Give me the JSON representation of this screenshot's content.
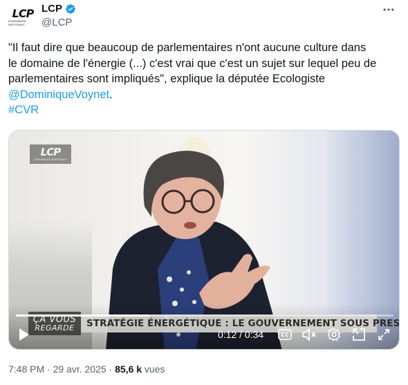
{
  "account": {
    "avatar_logo": "LCP",
    "avatar_logo_sub": "ASSEMBLÉE NATIONALE",
    "display_name": "LCP",
    "handle": "@LCP",
    "verified": true
  },
  "tweet": {
    "text_lines": [
      "\"Il faut dire que beaucoup de parlementaires n'ont aucune culture dans",
      "le domaine de l'énergie (...) c'est vrai que c'est un sujet sur lequel peu de",
      "parlementaires sont impliqués\", explique la députée Ecologiste"
    ],
    "mention": "@DominiqueVoynet",
    "mention_suffix": ".",
    "hashtag": "#CVR"
  },
  "video": {
    "watermark_main": "LCP",
    "watermark_sub": "ASSEMBLÉE NATIONALE",
    "show_logo_line1": "ÇA VOUS",
    "show_logo_line2": "REGARDE",
    "banner_text": "STRATÉGIE ÉNERGÉTIQUE : LE GOUVERNEMENT SOUS PRESSION",
    "time_display": "0:12 / 0:34",
    "progress_fraction": 0.353,
    "icons": [
      "play-icon",
      "captions-icon",
      "volume-muted-icon",
      "settings-gear-icon",
      "picture-in-picture-icon",
      "fullscreen-icon"
    ]
  },
  "meta": {
    "time": "7:48 PM",
    "separator": " · ",
    "date": "29 avr. 2025",
    "views_count": "85,6 k",
    "views_label": " vues"
  },
  "colors": {
    "link": "#1d9bf0",
    "verified": "#1d9bf0",
    "secondary_text": "#536471"
  }
}
